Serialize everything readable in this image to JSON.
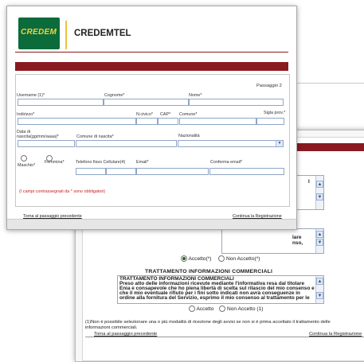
{
  "front": {
    "logo_text": "CREDEM",
    "brand": "CREDEMTEL",
    "step": "Passaggio 2",
    "labels": {
      "username": "Username (1)*",
      "cognome": "Cognome*",
      "nome": "Nome*",
      "indirizzo": "Indirizzo*",
      "civico": "N.civico*",
      "cap": "CAP*",
      "comune": "Comune*",
      "prov": "Sigla prov.*",
      "data_nascita": "Data di nascita(gg/mm/aaaa)*",
      "comune_nascita": "Comune di nascita*",
      "nazionalita": "Nazionalità",
      "maschio": "Maschio*",
      "femmina": "Femmina*",
      "telefono": "Telefono fisso Cellulare(4)",
      "email": "Email*",
      "conferma_email": "Conferma email*"
    },
    "note": "(I campi contrassegnati da * sono obbligatori)",
    "back_link": "Torna al passaggio precedente",
    "continue_link": "Continua la Registrazione"
  },
  "back": {
    "box1_fragment": "I",
    "box2_lines": [
      "lare",
      "nso,"
    ],
    "accetto1": "Accetto(*)",
    "non_accetto1": "Non Accetto(*)",
    "heading": "TRATTAMENTO INFORMAZIONI COMMERCIALI",
    "box3_lines": [
      "TRATTAMENTO INFORMAZIONI COMMERCIALI",
      "Preso atto delle informazioni ricevute mediante l'informativa resa dal titolare",
      "Enia e consapevole che ho piena libertà di scelta sul rilascio del mio consenso e",
      "che il mio eventuale rifiuto per i fini sotto indicati non avrà conseguenze in",
      "ordine alla fornitura del Servizio, esprimo il mio consenso al trattamento per le"
    ],
    "accetto2": "Accetto",
    "non_accetto2": "Non Accetto (1)",
    "footnote_1": "(1)Non è possibile selezionare una o più modalità di ricezione degli avvisi se non si è prima accettato il trattamento delle",
    "footnote_2": "informazioni commerciali.",
    "back_link": "Torna al passaggio precedente",
    "continue_link": "Continua la Registrazione"
  }
}
